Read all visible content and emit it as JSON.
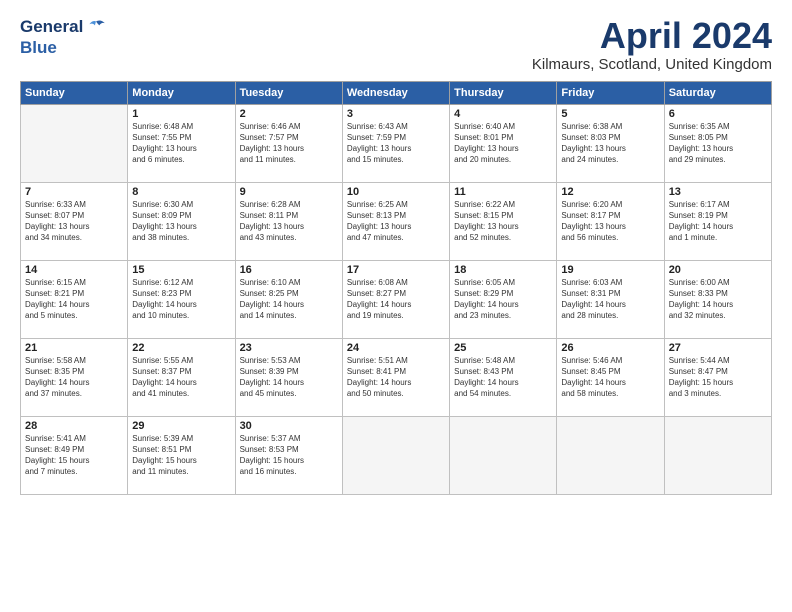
{
  "header": {
    "logo_line1": "General",
    "logo_line2": "Blue",
    "title": "April 2024",
    "location": "Kilmaurs, Scotland, United Kingdom"
  },
  "days_of_week": [
    "Sunday",
    "Monday",
    "Tuesday",
    "Wednesday",
    "Thursday",
    "Friday",
    "Saturday"
  ],
  "weeks": [
    [
      {
        "day": "",
        "info": ""
      },
      {
        "day": "1",
        "info": "Sunrise: 6:48 AM\nSunset: 7:55 PM\nDaylight: 13 hours\nand 6 minutes."
      },
      {
        "day": "2",
        "info": "Sunrise: 6:46 AM\nSunset: 7:57 PM\nDaylight: 13 hours\nand 11 minutes."
      },
      {
        "day": "3",
        "info": "Sunrise: 6:43 AM\nSunset: 7:59 PM\nDaylight: 13 hours\nand 15 minutes."
      },
      {
        "day": "4",
        "info": "Sunrise: 6:40 AM\nSunset: 8:01 PM\nDaylight: 13 hours\nand 20 minutes."
      },
      {
        "day": "5",
        "info": "Sunrise: 6:38 AM\nSunset: 8:03 PM\nDaylight: 13 hours\nand 24 minutes."
      },
      {
        "day": "6",
        "info": "Sunrise: 6:35 AM\nSunset: 8:05 PM\nDaylight: 13 hours\nand 29 minutes."
      }
    ],
    [
      {
        "day": "7",
        "info": "Sunrise: 6:33 AM\nSunset: 8:07 PM\nDaylight: 13 hours\nand 34 minutes."
      },
      {
        "day": "8",
        "info": "Sunrise: 6:30 AM\nSunset: 8:09 PM\nDaylight: 13 hours\nand 38 minutes."
      },
      {
        "day": "9",
        "info": "Sunrise: 6:28 AM\nSunset: 8:11 PM\nDaylight: 13 hours\nand 43 minutes."
      },
      {
        "day": "10",
        "info": "Sunrise: 6:25 AM\nSunset: 8:13 PM\nDaylight: 13 hours\nand 47 minutes."
      },
      {
        "day": "11",
        "info": "Sunrise: 6:22 AM\nSunset: 8:15 PM\nDaylight: 13 hours\nand 52 minutes."
      },
      {
        "day": "12",
        "info": "Sunrise: 6:20 AM\nSunset: 8:17 PM\nDaylight: 13 hours\nand 56 minutes."
      },
      {
        "day": "13",
        "info": "Sunrise: 6:17 AM\nSunset: 8:19 PM\nDaylight: 14 hours\nand 1 minute."
      }
    ],
    [
      {
        "day": "14",
        "info": "Sunrise: 6:15 AM\nSunset: 8:21 PM\nDaylight: 14 hours\nand 5 minutes."
      },
      {
        "day": "15",
        "info": "Sunrise: 6:12 AM\nSunset: 8:23 PM\nDaylight: 14 hours\nand 10 minutes."
      },
      {
        "day": "16",
        "info": "Sunrise: 6:10 AM\nSunset: 8:25 PM\nDaylight: 14 hours\nand 14 minutes."
      },
      {
        "day": "17",
        "info": "Sunrise: 6:08 AM\nSunset: 8:27 PM\nDaylight: 14 hours\nand 19 minutes."
      },
      {
        "day": "18",
        "info": "Sunrise: 6:05 AM\nSunset: 8:29 PM\nDaylight: 14 hours\nand 23 minutes."
      },
      {
        "day": "19",
        "info": "Sunrise: 6:03 AM\nSunset: 8:31 PM\nDaylight: 14 hours\nand 28 minutes."
      },
      {
        "day": "20",
        "info": "Sunrise: 6:00 AM\nSunset: 8:33 PM\nDaylight: 14 hours\nand 32 minutes."
      }
    ],
    [
      {
        "day": "21",
        "info": "Sunrise: 5:58 AM\nSunset: 8:35 PM\nDaylight: 14 hours\nand 37 minutes."
      },
      {
        "day": "22",
        "info": "Sunrise: 5:55 AM\nSunset: 8:37 PM\nDaylight: 14 hours\nand 41 minutes."
      },
      {
        "day": "23",
        "info": "Sunrise: 5:53 AM\nSunset: 8:39 PM\nDaylight: 14 hours\nand 45 minutes."
      },
      {
        "day": "24",
        "info": "Sunrise: 5:51 AM\nSunset: 8:41 PM\nDaylight: 14 hours\nand 50 minutes."
      },
      {
        "day": "25",
        "info": "Sunrise: 5:48 AM\nSunset: 8:43 PM\nDaylight: 14 hours\nand 54 minutes."
      },
      {
        "day": "26",
        "info": "Sunrise: 5:46 AM\nSunset: 8:45 PM\nDaylight: 14 hours\nand 58 minutes."
      },
      {
        "day": "27",
        "info": "Sunrise: 5:44 AM\nSunset: 8:47 PM\nDaylight: 15 hours\nand 3 minutes."
      }
    ],
    [
      {
        "day": "28",
        "info": "Sunrise: 5:41 AM\nSunset: 8:49 PM\nDaylight: 15 hours\nand 7 minutes."
      },
      {
        "day": "29",
        "info": "Sunrise: 5:39 AM\nSunset: 8:51 PM\nDaylight: 15 hours\nand 11 minutes."
      },
      {
        "day": "30",
        "info": "Sunrise: 5:37 AM\nSunset: 8:53 PM\nDaylight: 15 hours\nand 16 minutes."
      },
      {
        "day": "",
        "info": ""
      },
      {
        "day": "",
        "info": ""
      },
      {
        "day": "",
        "info": ""
      },
      {
        "day": "",
        "info": ""
      }
    ]
  ]
}
